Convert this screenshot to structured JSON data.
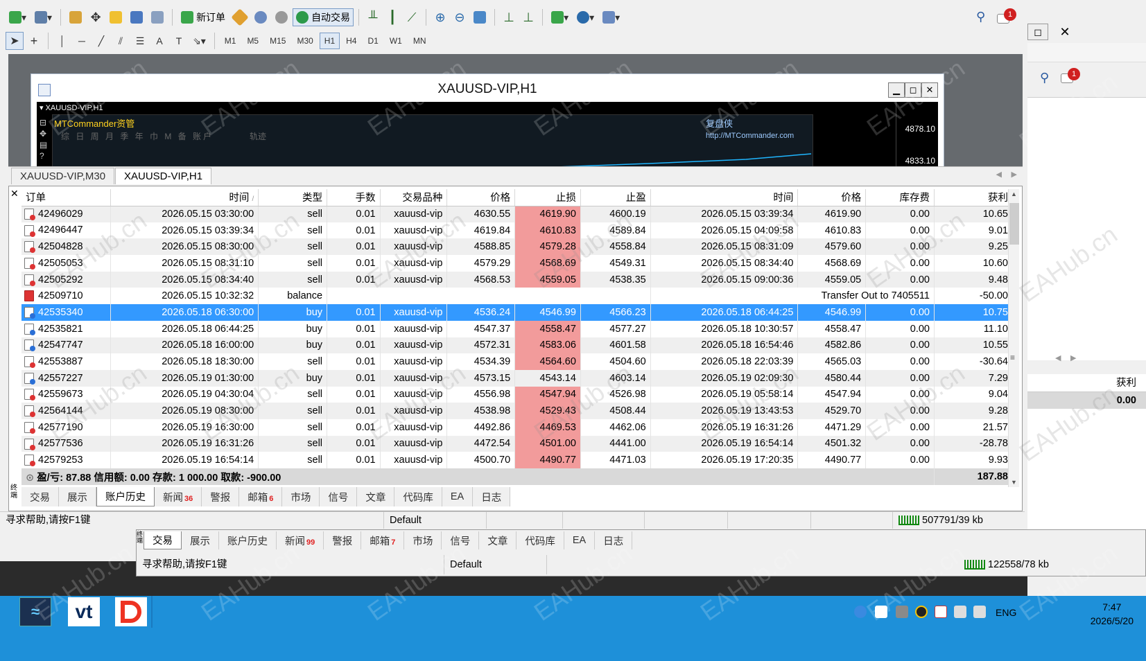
{
  "toolbar": {
    "new_order_label": "新订单",
    "auto_trade_label": "自动交易",
    "timeframes": [
      "M1",
      "M5",
      "M15",
      "M30",
      "H1",
      "H4",
      "D1",
      "W1",
      "MN"
    ],
    "active_timeframe": "H1",
    "notification_count": "1"
  },
  "chart": {
    "window_title": "XAUUSD-VIP,H1",
    "symbol_label": "XAUUSD-VIP,H1",
    "indicator_name": "MTCommander资管",
    "indicator_periods": "综 日 周 月 季 年 巾 M 备 账户",
    "indicator_track": "轨迹",
    "brand_label": "复盘侠",
    "brand_url": "http://MTCommander.com",
    "price_top": "4878.10",
    "price_bottom": "4833.10"
  },
  "chart_tabs": [
    "XAUUSD-VIP,M30",
    "XAUUSD-VIP,H1"
  ],
  "terminal": {
    "columns": [
      "订单",
      "时间",
      "类型",
      "手数",
      "交易品种",
      "价格",
      "止损",
      "止盈",
      "时间",
      "价格",
      "库存费",
      "获利"
    ],
    "rows": [
      {
        "order": "42496029",
        "open_time": "2026.05.15 03:30:00",
        "type": "sell",
        "lots": "0.01",
        "symbol": "xauusd-vip",
        "open_price": "4630.55",
        "sl": "4619.90",
        "tp": "4600.19",
        "close_time": "2026.05.15 03:39:34",
        "close_price": "4619.90",
        "swap": "0.00",
        "profit": "10.65",
        "sl_hit": true
      },
      {
        "order": "42496447",
        "open_time": "2026.05.15 03:39:34",
        "type": "sell",
        "lots": "0.01",
        "symbol": "xauusd-vip",
        "open_price": "4619.84",
        "sl": "4610.83",
        "tp": "4589.84",
        "close_time": "2026.05.15 04:09:58",
        "close_price": "4610.83",
        "swap": "0.00",
        "profit": "9.01",
        "sl_hit": true
      },
      {
        "order": "42504828",
        "open_time": "2026.05.15 08:30:00",
        "type": "sell",
        "lots": "0.01",
        "symbol": "xauusd-vip",
        "open_price": "4588.85",
        "sl": "4579.28",
        "tp": "4558.84",
        "close_time": "2026.05.15 08:31:09",
        "close_price": "4579.60",
        "swap": "0.00",
        "profit": "9.25",
        "sl_hit": true
      },
      {
        "order": "42505053",
        "open_time": "2026.05.15 08:31:10",
        "type": "sell",
        "lots": "0.01",
        "symbol": "xauusd-vip",
        "open_price": "4579.29",
        "sl": "4568.69",
        "tp": "4549.31",
        "close_time": "2026.05.15 08:34:40",
        "close_price": "4568.69",
        "swap": "0.00",
        "profit": "10.60",
        "sl_hit": true
      },
      {
        "order": "42505292",
        "open_time": "2026.05.15 08:34:40",
        "type": "sell",
        "lots": "0.01",
        "symbol": "xauusd-vip",
        "open_price": "4568.53",
        "sl": "4559.05",
        "tp": "4538.35",
        "close_time": "2026.05.15 09:00:36",
        "close_price": "4559.05",
        "swap": "0.00",
        "profit": "9.48",
        "sl_hit": true
      },
      {
        "order": "42509710",
        "open_time": "2026.05.15 10:32:32",
        "type": "balance",
        "lots": "",
        "symbol": "",
        "open_price": "",
        "sl": "",
        "tp": "",
        "close_time": "",
        "close_price": "Transfer Out to 7405511",
        "swap": "",
        "profit": "-50.00",
        "sl_hit": false,
        "is_balance": true
      },
      {
        "order": "42535340",
        "open_time": "2026.05.18 06:30:00",
        "type": "buy",
        "lots": "0.01",
        "symbol": "xauusd-vip",
        "open_price": "4536.24",
        "sl": "4546.99",
        "tp": "4566.23",
        "close_time": "2026.05.18 06:44:25",
        "close_price": "4546.99",
        "swap": "0.00",
        "profit": "10.75",
        "sl_hit": true,
        "selected": true
      },
      {
        "order": "42535821",
        "open_time": "2026.05.18 06:44:25",
        "type": "buy",
        "lots": "0.01",
        "symbol": "xauusd-vip",
        "open_price": "4547.37",
        "sl": "4558.47",
        "tp": "4577.27",
        "close_time": "2026.05.18 10:30:57",
        "close_price": "4558.47",
        "swap": "0.00",
        "profit": "11.10",
        "sl_hit": true
      },
      {
        "order": "42547747",
        "open_time": "2026.05.18 16:00:00",
        "type": "buy",
        "lots": "0.01",
        "symbol": "xauusd-vip",
        "open_price": "4572.31",
        "sl": "4583.06",
        "tp": "4601.58",
        "close_time": "2026.05.18 16:54:46",
        "close_price": "4582.86",
        "swap": "0.00",
        "profit": "10.55",
        "sl_hit": true
      },
      {
        "order": "42553887",
        "open_time": "2026.05.18 18:30:00",
        "type": "sell",
        "lots": "0.01",
        "symbol": "xauusd-vip",
        "open_price": "4534.39",
        "sl": "4564.60",
        "tp": "4504.60",
        "close_time": "2026.05.18 22:03:39",
        "close_price": "4565.03",
        "swap": "0.00",
        "profit": "-30.64",
        "sl_hit": true
      },
      {
        "order": "42557227",
        "open_time": "2026.05.19 01:30:00",
        "type": "buy",
        "lots": "0.01",
        "symbol": "xauusd-vip",
        "open_price": "4573.15",
        "sl": "4543.14",
        "tp": "4603.14",
        "close_time": "2026.05.19 02:09:30",
        "close_price": "4580.44",
        "swap": "0.00",
        "profit": "7.29",
        "sl_hit": false
      },
      {
        "order": "42559673",
        "open_time": "2026.05.19 04:30:04",
        "type": "sell",
        "lots": "0.01",
        "symbol": "xauusd-vip",
        "open_price": "4556.98",
        "sl": "4547.94",
        "tp": "4526.98",
        "close_time": "2026.05.19 05:58:14",
        "close_price": "4547.94",
        "swap": "0.00",
        "profit": "9.04",
        "sl_hit": true
      },
      {
        "order": "42564144",
        "open_time": "2026.05.19 08:30:00",
        "type": "sell",
        "lots": "0.01",
        "symbol": "xauusd-vip",
        "open_price": "4538.98",
        "sl": "4529.43",
        "tp": "4508.44",
        "close_time": "2026.05.19 13:43:53",
        "close_price": "4529.70",
        "swap": "0.00",
        "profit": "9.28",
        "sl_hit": true
      },
      {
        "order": "42577190",
        "open_time": "2026.05.19 16:30:00",
        "type": "sell",
        "lots": "0.01",
        "symbol": "xauusd-vip",
        "open_price": "4492.86",
        "sl": "4469.53",
        "tp": "4462.06",
        "close_time": "2026.05.19 16:31:26",
        "close_price": "4471.29",
        "swap": "0.00",
        "profit": "21.57",
        "sl_hit": true
      },
      {
        "order": "42577536",
        "open_time": "2026.05.19 16:31:26",
        "type": "sell",
        "lots": "0.01",
        "symbol": "xauusd-vip",
        "open_price": "4472.54",
        "sl": "4501.00",
        "tp": "4441.00",
        "close_time": "2026.05.19 16:54:14",
        "close_price": "4501.32",
        "swap": "0.00",
        "profit": "-28.78",
        "sl_hit": true
      },
      {
        "order": "42579253",
        "open_time": "2026.05.19 16:54:14",
        "type": "sell",
        "lots": "0.01",
        "symbol": "xauusd-vip",
        "open_price": "4500.70",
        "sl": "4490.77",
        "tp": "4471.03",
        "close_time": "2026.05.19 17:20:35",
        "close_price": "4490.77",
        "swap": "0.00",
        "profit": "9.93",
        "sl_hit": true
      }
    ],
    "summary_text": "盈/亏: 87.88  信用额: 0.00  存款: 1 000.00  取款: -900.00",
    "summary_total": "187.88",
    "tabs": [
      {
        "label": "交易",
        "badge": ""
      },
      {
        "label": "展示",
        "badge": ""
      },
      {
        "label": "账户历史",
        "badge": "",
        "active": true
      },
      {
        "label": "新闻",
        "badge": "36"
      },
      {
        "label": "警报",
        "badge": ""
      },
      {
        "label": "邮箱",
        "badge": "6"
      },
      {
        "label": "市场",
        "badge": ""
      },
      {
        "label": "信号",
        "badge": ""
      },
      {
        "label": "文章",
        "badge": ""
      },
      {
        "label": "代码库",
        "badge": ""
      },
      {
        "label": "EA",
        "badge": ""
      },
      {
        "label": "日志",
        "badge": ""
      }
    ],
    "side_label": "终端"
  },
  "status_bar": {
    "help": "寻求帮助,请按F1键",
    "profile": "Default",
    "traffic": "507791/39 kb"
  },
  "bg_window": {
    "tabs": [
      {
        "label": "交易",
        "badge": "",
        "active": true
      },
      {
        "label": "展示",
        "badge": ""
      },
      {
        "label": "账户历史",
        "badge": ""
      },
      {
        "label": "新闻",
        "badge": "99"
      },
      {
        "label": "警报",
        "badge": ""
      },
      {
        "label": "邮箱",
        "badge": "7"
      },
      {
        "label": "市场",
        "badge": ""
      },
      {
        "label": "信号",
        "badge": ""
      },
      {
        "label": "文章",
        "badge": ""
      },
      {
        "label": "代码库",
        "badge": ""
      },
      {
        "label": "EA",
        "badge": ""
      },
      {
        "label": "日志",
        "badge": ""
      }
    ],
    "help": "寻求帮助,请按F1键",
    "profile": "Default",
    "traffic": "122558/78 kb"
  },
  "right_panel": {
    "profit_header": "获利",
    "profit_value": "0.00",
    "notification_count": "1"
  },
  "taskbar": {
    "apps": [
      "vt"
    ],
    "lang": "ENG",
    "time": "7:47",
    "date": "2026/5/20"
  },
  "watermark": "EAHub.cn",
  "colors": {
    "selected_row": "#3399ff",
    "sl_hit": "#f29b9b",
    "taskbar": "#1e90d9",
    "chart_line": "#1fb6ff"
  }
}
